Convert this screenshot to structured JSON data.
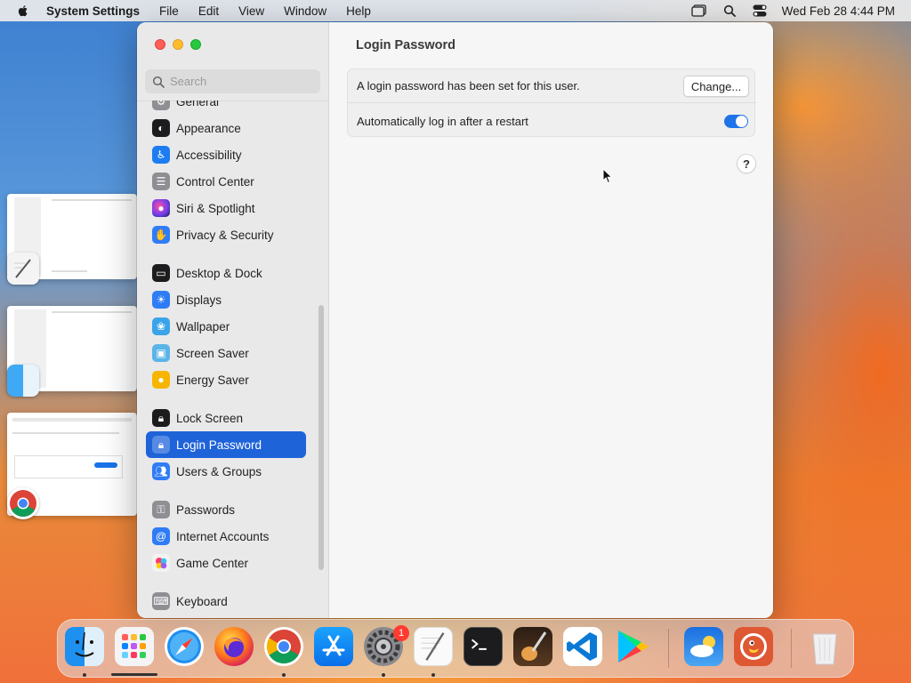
{
  "menubar": {
    "app_name": "System Settings",
    "menus": [
      "File",
      "Edit",
      "View",
      "Window",
      "Help"
    ],
    "clock": "Wed Feb 28  4:44 PM"
  },
  "window": {
    "search": {
      "placeholder": "Search"
    },
    "sidebar": {
      "items": [
        {
          "label": "General",
          "icon": "gear-icon",
          "color": "#8e8e93",
          "selected": false
        },
        {
          "label": "Appearance",
          "icon": "appearance-icon",
          "color": "#1c1c1e",
          "selected": false
        },
        {
          "label": "Accessibility",
          "icon": "accessibility-icon",
          "color": "#1e7cf2",
          "selected": false
        },
        {
          "label": "Control Center",
          "icon": "control-center-icon",
          "color": "#8e8e93",
          "selected": false
        },
        {
          "label": "Siri & Spotlight",
          "icon": "siri-icon",
          "color": "#b045d6",
          "selected": false
        },
        {
          "label": "Privacy & Security",
          "icon": "hand-icon",
          "color": "#2f7cf6",
          "selected": false
        },
        {
          "label": "Desktop & Dock",
          "icon": "dock-icon",
          "color": "#1c1c1e",
          "selected": false
        },
        {
          "label": "Displays",
          "icon": "displays-icon",
          "color": "#2f7cf6",
          "selected": false
        },
        {
          "label": "Wallpaper",
          "icon": "wallpaper-icon",
          "color": "#3aa4e8",
          "selected": false
        },
        {
          "label": "Screen Saver",
          "icon": "screen-saver-icon",
          "color": "#5ab4e8",
          "selected": false
        },
        {
          "label": "Energy Saver",
          "icon": "energy-icon",
          "color": "#f7b500",
          "selected": false
        },
        {
          "label": "Lock Screen",
          "icon": "lock-screen-icon",
          "color": "#1c1c1e",
          "selected": false
        },
        {
          "label": "Login Password",
          "icon": "lock-icon",
          "color": "#8e8e93",
          "selected": true
        },
        {
          "label": "Users & Groups",
          "icon": "users-icon",
          "color": "#2f7cf6",
          "selected": false
        },
        {
          "label": "Passwords",
          "icon": "key-icon",
          "color": "#8e8e93",
          "selected": false
        },
        {
          "label": "Internet Accounts",
          "icon": "at-icon",
          "color": "#2f7cf6",
          "selected": false
        },
        {
          "label": "Game Center",
          "icon": "game-center-icon",
          "color": "#f2f2f2",
          "selected": false
        },
        {
          "label": "Keyboard",
          "icon": "keyboard-icon",
          "color": "#8e8e93",
          "selected": false
        }
      ]
    },
    "content": {
      "title": "Login Password",
      "password_row_label": "A login password has been set for this user.",
      "change_button": "Change...",
      "autologin_label": "Automatically log in after a restart",
      "autologin_enabled": true,
      "help_label": "?"
    }
  },
  "dock": {
    "settings_badge": "1",
    "apps": [
      "Finder",
      "Launchpad",
      "Safari",
      "Firefox",
      "Google Chrome",
      "App Store",
      "System Settings",
      "TextEdit",
      "Terminal",
      "GarageBand",
      "Visual Studio Code",
      "Google Play",
      "Weather",
      "DuckDuckGo",
      "Trash"
    ]
  },
  "colors": {
    "accent": "#1f63d9",
    "toggle": "#1f74e8"
  }
}
